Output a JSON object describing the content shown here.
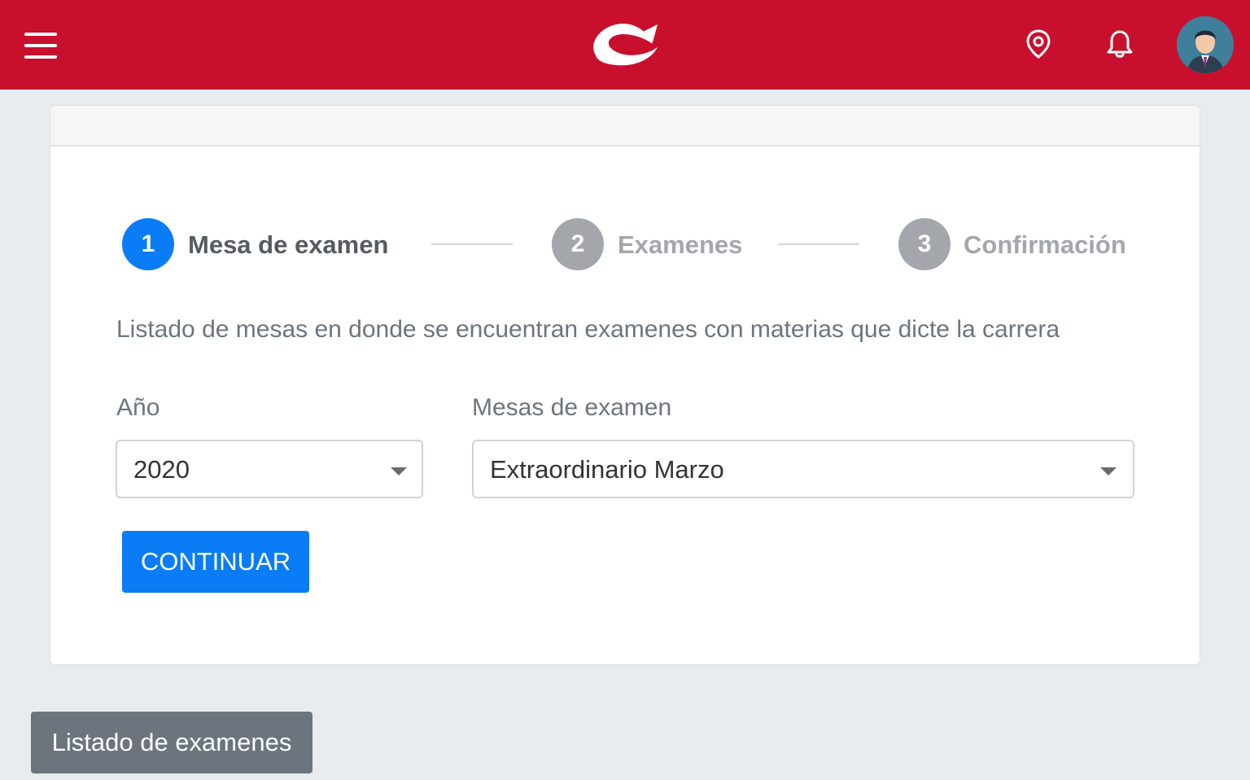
{
  "colors": {
    "topbar": "#c8102e",
    "active_step": "#0a7cf5",
    "inactive_step": "#a3a7ac",
    "primary_button": "#0a7cf5",
    "secondary_button": "#6c757d"
  },
  "header": {
    "menu_icon": "hamburger-icon",
    "logo_icon": "brand-logo",
    "location_icon": "map-pin-icon",
    "notification_icon": "bell-icon",
    "avatar_icon": "user-avatar"
  },
  "stepper": {
    "steps": [
      {
        "number": "1",
        "label": "Mesa de examen",
        "state": "active"
      },
      {
        "number": "2",
        "label": "Examenes",
        "state": "inactive"
      },
      {
        "number": "3",
        "label": "Confirmación",
        "state": "inactive"
      }
    ]
  },
  "form": {
    "description": "Listado de mesas en donde se encuentran examenes con materias que dicte la carrera",
    "year_label": "Año",
    "year_value": "2020",
    "exam_label": "Mesas de examen",
    "exam_value": "Extraordinario Marzo",
    "continue_label": "CONTINUAR"
  },
  "footer": {
    "list_button_label": "Listado de examenes"
  }
}
